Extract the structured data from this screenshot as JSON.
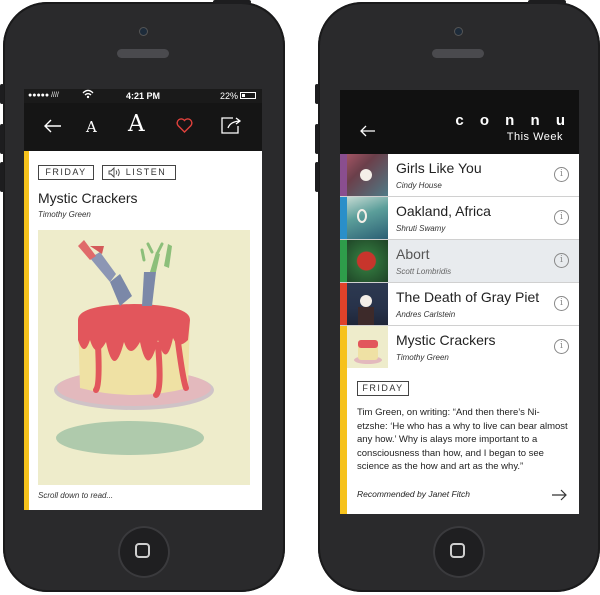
{
  "left_screen": {
    "status": {
      "signal": "●●●●● ////",
      "time": "4:21 PM",
      "battery": "22%"
    },
    "nav": {
      "back_icon": "arrow-left-icon",
      "small_font_label": "A",
      "large_font_label": "A",
      "heart_icon": "heart-icon",
      "share_icon": "share-icon"
    },
    "day_tag": "FRIDAY",
    "listen_label": "LISTEN",
    "article_title": "Mystic Crackers",
    "article_author": "Timothy Green",
    "scroll_hint": "Scroll down to read...",
    "accent": "#f6c21c",
    "heart_color": "#e0413c"
  },
  "right_screen": {
    "header": {
      "brand": "c o n n u",
      "subtitle": "This Week",
      "back_icon": "arrow-left-icon"
    },
    "items": [
      {
        "title": "Girls Like You",
        "author": "Cindy House",
        "stripe": "#8a4e8f"
      },
      {
        "title": "Oakland, Africa",
        "author": "Shruti Swamy",
        "stripe": "#2a8fc9"
      },
      {
        "title": "Abort",
        "author": "Scott Lombridis",
        "stripe": "#2e9d4a"
      },
      {
        "title": "The Death of Gray Piet",
        "author": "Andres Carlstein",
        "stripe": "#e0422a"
      },
      {
        "title": "Mystic Crackers",
        "author": "Timothy Green",
        "stripe": "#f6c21c"
      }
    ],
    "day_tag": "FRIDAY",
    "excerpt": "Tim Green, on writing: “And then there’s Ni-etzshe: ‘He who has a why to live can bear almost any how.’ Why is alays more important to a consciousness than how, and I began to see science as the how and art as the why.”",
    "recommended": "Recommended by Janet Fitch",
    "next_icon": "arrow-right-icon"
  }
}
